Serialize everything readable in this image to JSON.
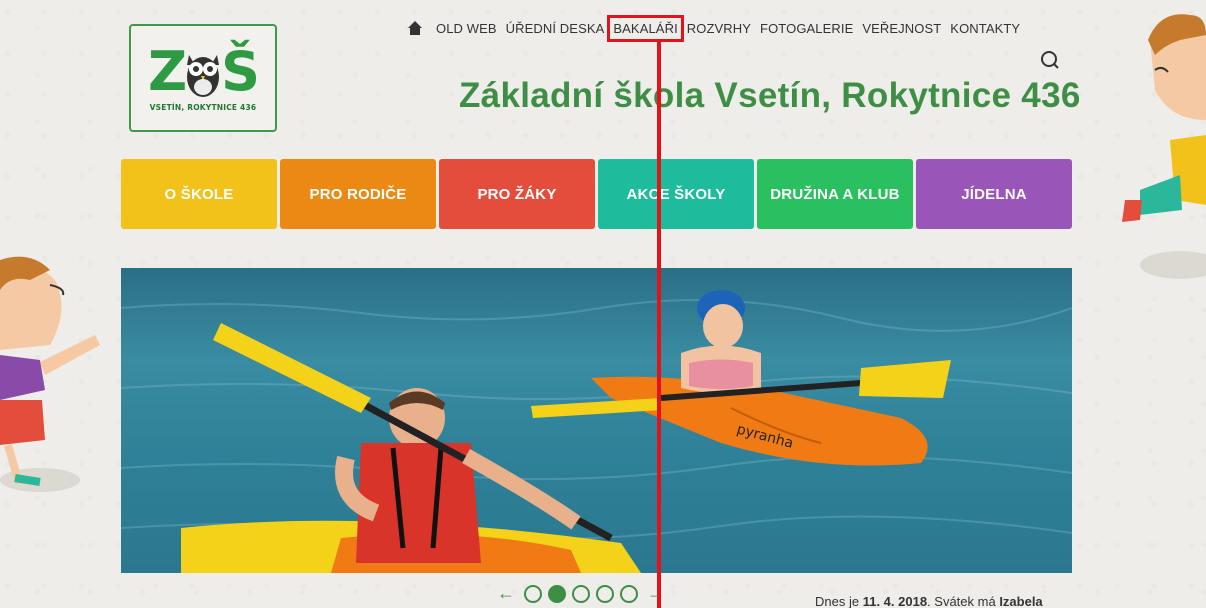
{
  "logo": {
    "mark_left": "Z",
    "mark_right": "Š",
    "caption": "VSETÍN, ROKYTNICE 436",
    "brand_color": "#2f9a44"
  },
  "topnav": {
    "home_icon": "home-icon",
    "items": [
      "OLD WEB",
      "ÚŘEDNÍ DESKA",
      "BAKALÁŘI",
      "ROZVRHY",
      "FOTOGALERIE",
      "VEŘEJNOST",
      "KONTAKTY"
    ],
    "highlighted": "BAKALÁŘI",
    "highlight_color": "#e2131b"
  },
  "search": {
    "icon": "search-icon"
  },
  "site_title": "Základní škola Vsetín, Rokytnice 436",
  "tiles": [
    {
      "label": "O ŠKOLE",
      "color": "#f2c11a"
    },
    {
      "label": "PRO RODIČE",
      "color": "#ea8a14"
    },
    {
      "label": "PRO ŽÁKY",
      "color": "#e34d3b"
    },
    {
      "label": "AKCE ŠKOLY",
      "color": "#1ebc9c"
    },
    {
      "label": "DRUŽINA A KLUB",
      "color": "#2bc05f"
    },
    {
      "label": "JÍDELNA",
      "color": "#9a55b8"
    }
  ],
  "slider": {
    "prev": "←",
    "next": "→",
    "dot_count": 5,
    "active_index": 1,
    "kayak_text": "pyranha"
  },
  "today": {
    "prefix": "Dnes je",
    "date": "11. 4. 2018",
    "middle": ". Svátek má",
    "name": "Izabela"
  }
}
